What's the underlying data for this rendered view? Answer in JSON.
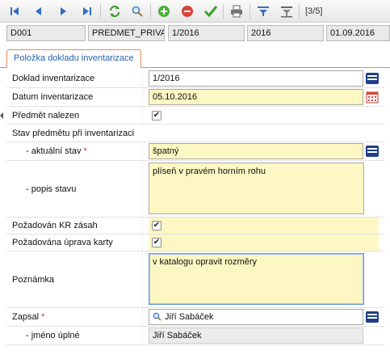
{
  "toolbar": {
    "record_position": "[3/5]",
    "icons": [
      "first-record-icon",
      "previous-record-icon",
      "next-record-icon",
      "last-record-icon",
      "refresh-icon",
      "search-icon",
      "add-icon",
      "delete-icon",
      "confirm-icon",
      "print-icon",
      "filter-icon",
      "filter-clear-icon"
    ]
  },
  "infobar": {
    "cells": [
      "D001",
      "PREDMET_PRIVA",
      "1/2016",
      "2016",
      "01.09.2016"
    ]
  },
  "tab": {
    "label": "Položka dokladu inventarizace"
  },
  "form": {
    "doklad": {
      "label": "Doklad inventarizace",
      "value": "1/2016"
    },
    "datum": {
      "label": "Datum inventarizace",
      "value": "05.10.2016"
    },
    "nalezen": {
      "label": "Předmět nalezen",
      "checked": true
    },
    "section_title": "Stav předmětu při inventarizaci",
    "aktualni_stav": {
      "label": "- aktuální stav",
      "required_mark": "*",
      "value": "špatný"
    },
    "popis_stavu": {
      "label": "- popis stavu",
      "value": "plíseň v pravém horním rohu"
    },
    "kr_zasah": {
      "label": "Požadován KR zásah",
      "checked": true
    },
    "uprava_karty": {
      "label": "Požadována úprava karty",
      "checked": true
    },
    "poznamka": {
      "label": "Poznámka",
      "value": "v katalogu opravit rozměry"
    },
    "zapsal": {
      "label": "Zapsal",
      "required_mark": "*",
      "value": "Jiří Sabáček"
    },
    "jmeno_uplne": {
      "label": "- jméno úplné",
      "value": "Jiří Sabáček"
    }
  },
  "colors": {
    "required_field_bg": "#fdf7c3",
    "tab_border": "#e38a56",
    "tab_text": "#2a62a8",
    "required_mark": "#d23030"
  }
}
